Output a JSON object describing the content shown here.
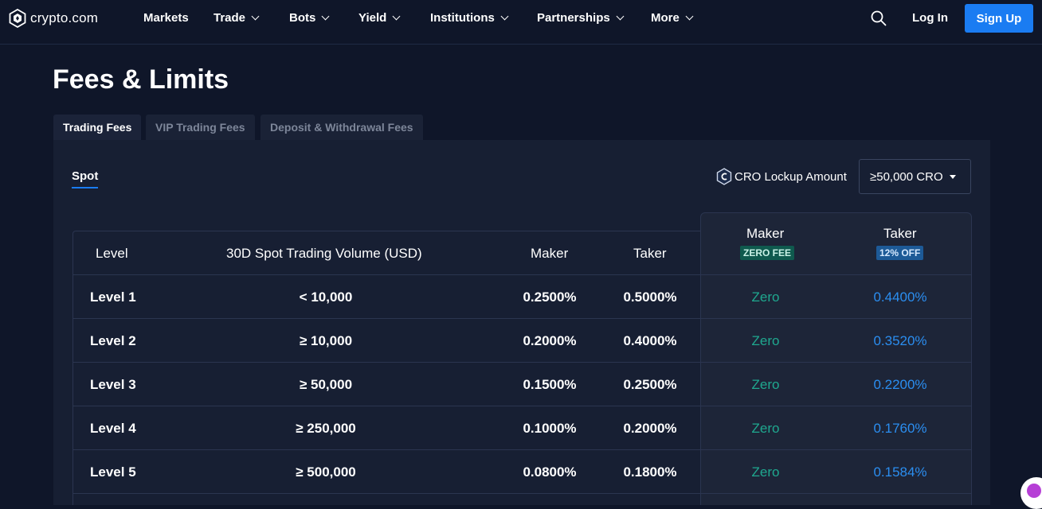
{
  "nav": {
    "logo_text": "crypto.com",
    "items": [
      {
        "label": "Markets",
        "dropdown": false
      },
      {
        "label": "Trade",
        "dropdown": true
      },
      {
        "label": "Bots",
        "dropdown": true
      },
      {
        "label": "Yield",
        "dropdown": true
      },
      {
        "label": "Institutions",
        "dropdown": true
      },
      {
        "label": "Partnerships",
        "dropdown": true
      },
      {
        "label": "More",
        "dropdown": true
      }
    ],
    "search_icon": "search-icon",
    "login_label": "Log In",
    "signup_label": "Sign Up"
  },
  "page_title": "Fees & Limits",
  "tabs": [
    {
      "label": "Trading Fees",
      "active": true
    },
    {
      "label": "VIP Trading Fees",
      "active": false
    },
    {
      "label": "Deposit & Withdrawal Fees",
      "active": false
    }
  ],
  "panel": {
    "spot_tab": "Spot",
    "cro_lockup_label": "CRO Lockup Amount",
    "cro_lockup_value": "≥50,000 CRO"
  },
  "table": {
    "headers": {
      "level": "Level",
      "volume": "30D Spot Trading Volume (USD)",
      "maker": "Maker",
      "taker": "Taker",
      "maker_cro": "Maker",
      "maker_cro_badge": "ZERO FEE",
      "taker_cro": "Taker",
      "taker_cro_badge": "12% OFF"
    },
    "rows": [
      {
        "level": "Level 1",
        "volume": "< 10,000",
        "maker": "0.2500%",
        "taker": "0.5000%",
        "maker_cro": "Zero",
        "taker_cro": "0.4400%"
      },
      {
        "level": "Level 2",
        "volume": "≥ 10,000",
        "maker": "0.2000%",
        "taker": "0.4000%",
        "maker_cro": "Zero",
        "taker_cro": "0.3520%"
      },
      {
        "level": "Level 3",
        "volume": "≥ 50,000",
        "maker": "0.1500%",
        "taker": "0.2500%",
        "maker_cro": "Zero",
        "taker_cro": "0.2200%"
      },
      {
        "level": "Level 4",
        "volume": "≥ 250,000",
        "maker": "0.1000%",
        "taker": "0.2000%",
        "maker_cro": "Zero",
        "taker_cro": "0.1760%"
      },
      {
        "level": "Level 5",
        "volume": "≥ 500,000",
        "maker": "0.0800%",
        "taker": "0.1800%",
        "maker_cro": "Zero",
        "taker_cro": "0.1584%"
      }
    ]
  },
  "colors": {
    "background": "#0f1629",
    "panel": "#171f33",
    "accent": "#1a7cf2",
    "zero_green": "#1fa88f",
    "discount_blue": "#2b8ef0"
  }
}
